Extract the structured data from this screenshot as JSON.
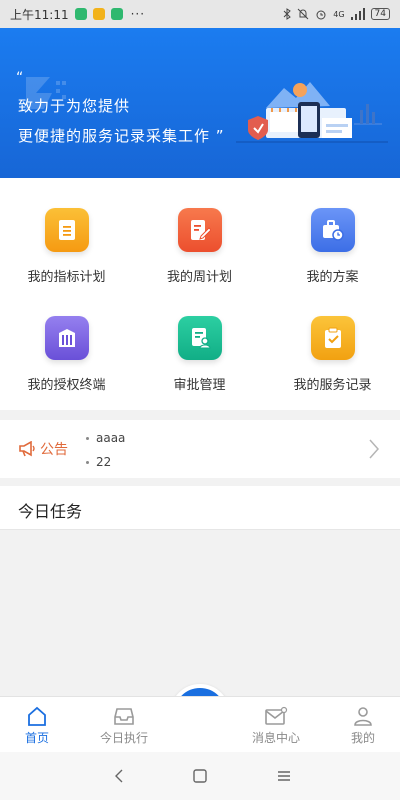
{
  "status_bar": {
    "time": "上午11:11",
    "app_icon_colors": [
      "#2fb86f",
      "#f2b21b",
      "#2fb86f"
    ],
    "more": "···",
    "signal_label": "4G",
    "battery": "74"
  },
  "banner": {
    "quote_open": "“",
    "line1": "致力于为您提供",
    "line2": "更便捷的服务记录采集工作 ”",
    "background": "#1b7cf0"
  },
  "grid": {
    "items": [
      {
        "label": "我的指标计划",
        "icon": "list-doc-icon",
        "color": "#f7a81c"
      },
      {
        "label": "我的周计划",
        "icon": "edit-doc-icon",
        "color": "#f0643c"
      },
      {
        "label": "我的方案",
        "icon": "briefcase-clock-icon",
        "color": "#4f7cf0"
      },
      {
        "label": "我的授权终端",
        "icon": "building-icon",
        "color": "#7a62e0"
      },
      {
        "label": "审批管理",
        "icon": "approval-doc-icon",
        "color": "#16b990"
      },
      {
        "label": "我的服务记录",
        "icon": "clipboard-check-icon",
        "color": "#f5b21c"
      }
    ]
  },
  "notice": {
    "label": "公告",
    "items": [
      "aaaa",
      "22"
    ],
    "color": "#e06a3b"
  },
  "today": {
    "title": "今日任务"
  },
  "tabbar": {
    "active_color": "#1b6fe0",
    "tabs": [
      {
        "label": "首页",
        "icon": "home-icon"
      },
      {
        "label": "今日执行",
        "icon": "inbox-icon"
      },
      {
        "label": "消息中心",
        "icon": "mail-icon"
      },
      {
        "label": "我的",
        "icon": "user-icon"
      }
    ],
    "center_icon": "write-note-icon"
  }
}
